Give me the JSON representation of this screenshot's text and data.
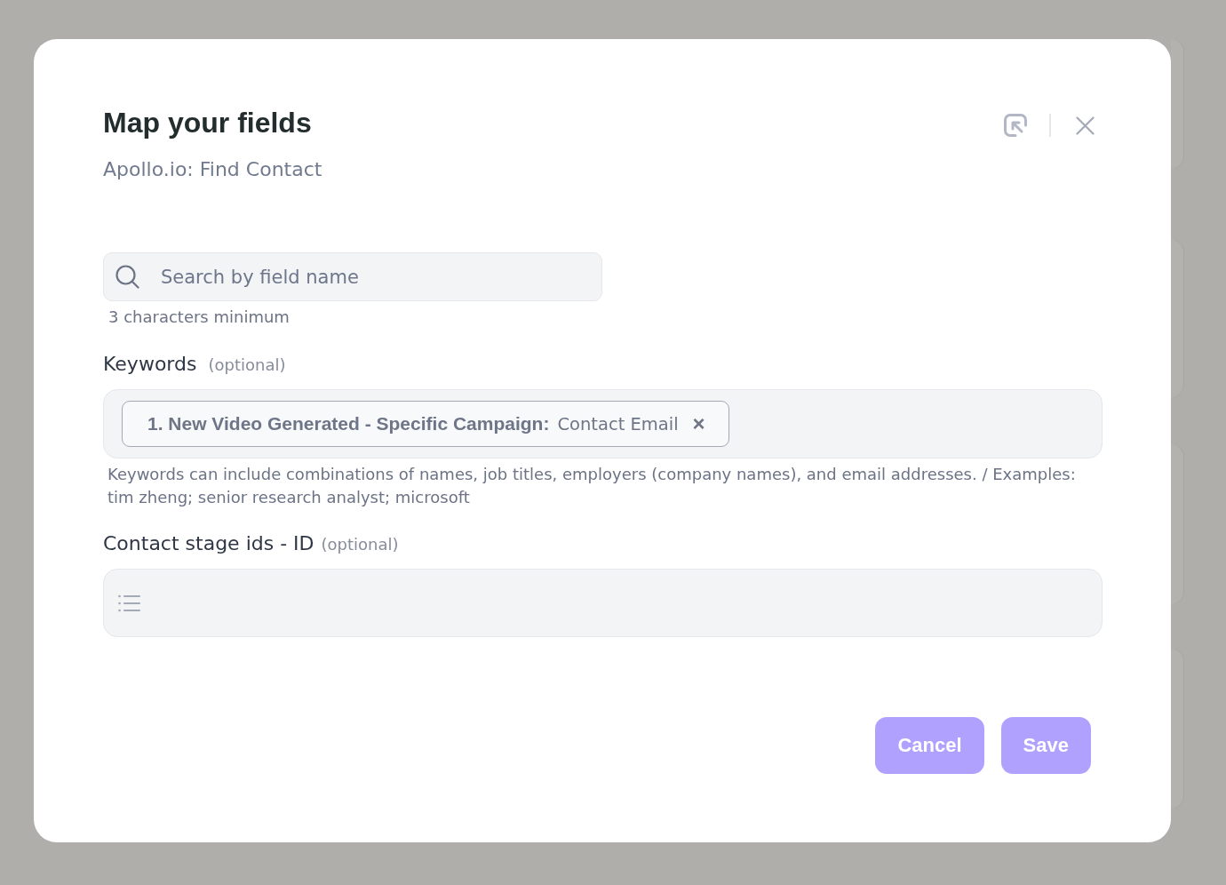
{
  "dialog": {
    "title": "Map your fields",
    "subtitle": "Apollo.io: Find Contact"
  },
  "search": {
    "placeholder": "Search by field name",
    "hint": "3 characters minimum"
  },
  "fields": [
    {
      "kind": "tags",
      "label": "Keywords",
      "optional": "(optional)",
      "tags": [
        {
          "source": "1. New Video Generated - Specific Campaign:",
          "value": "Contact Email",
          "remove": "×"
        }
      ],
      "help": "Keywords can include combinations of names, job titles, employers (company names), and email addresses. / Examples: tim zheng; senior research analyst; microsoft"
    },
    {
      "kind": "list",
      "label": "Contact stage ids - ID",
      "optional": "(optional)"
    }
  ],
  "buttons": [
    {
      "label": "Cancel",
      "disabled": true
    },
    {
      "label": "Save",
      "disabled": true
    }
  ]
}
